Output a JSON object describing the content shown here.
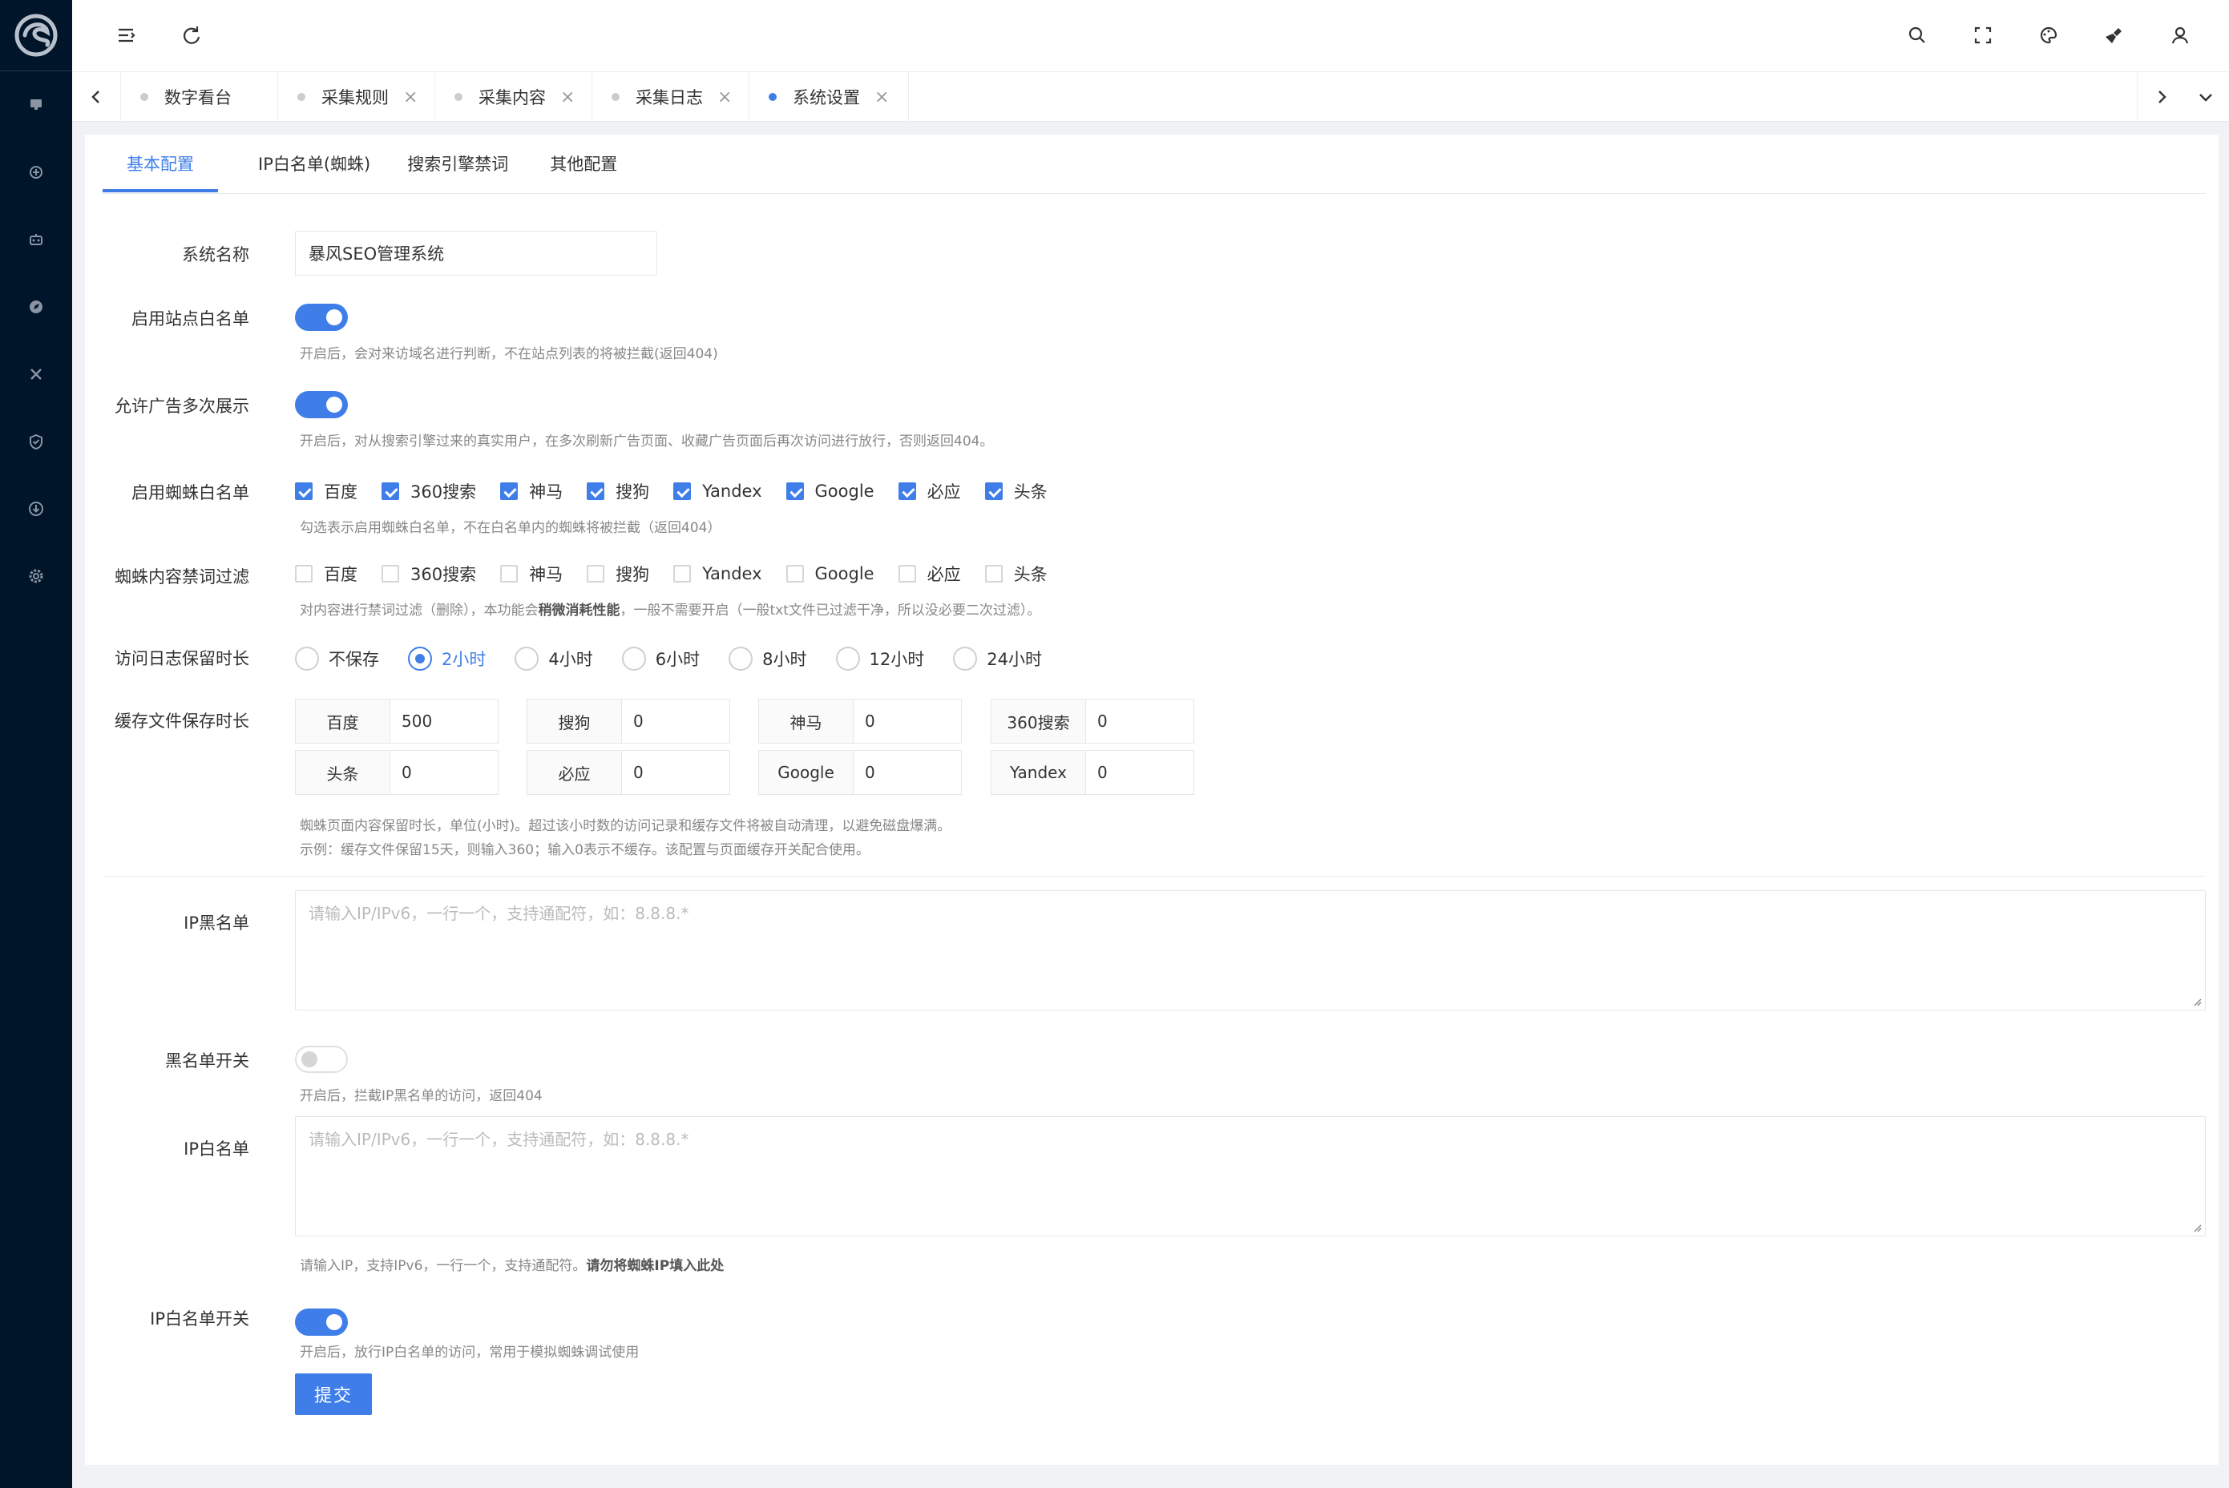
{
  "sidebar": {
    "icons": [
      "dashboard-icon",
      "rules-icon",
      "robot-icon",
      "compass-icon",
      "tools-icon",
      "shield-icon",
      "download-icon",
      "settings-icon"
    ]
  },
  "topbar": {
    "left_icons": [
      "menu-fold-icon",
      "refresh-icon"
    ],
    "right_icons": [
      "search-icon",
      "fullscreen-icon",
      "palette-icon",
      "clean-icon",
      "user-icon"
    ]
  },
  "view_tabs": [
    {
      "label": "数字看台",
      "closable": false,
      "active": false
    },
    {
      "label": "采集规则",
      "closable": true,
      "active": false
    },
    {
      "label": "采集内容",
      "closable": true,
      "active": false
    },
    {
      "label": "采集日志",
      "closable": true,
      "active": false
    },
    {
      "label": "系统设置",
      "closable": true,
      "active": true
    }
  ],
  "form_tabs": [
    "基本配置",
    "IP白名单(蜘蛛)",
    "搜索引擎禁词",
    "其他配置"
  ],
  "labels": {
    "system_name": "系统名称",
    "site_whitelist": "启用站点白名单",
    "ad_multi": "允许广告多次展示",
    "spider_whitelist": "启用蜘蛛白名单",
    "spider_filter": "蜘蛛内容禁词过滤",
    "log_keep": "访问日志保留时长",
    "cache_keep": "缓存文件保存时长",
    "ip_blacklist": "IP黑名单",
    "blacklist_switch": "黑名单开关",
    "ip_whitelist": "IP白名单",
    "ip_whitelist_switch": "IP白名单开关"
  },
  "values": {
    "system_name": "暴风SEO管理系统"
  },
  "hints": {
    "site_whitelist": "开启后，会对来访域名进行判断，不在站点列表的将被拦截(返回404)",
    "ad_multi": "开启后，对从搜索引擎过来的真实用户，在多次刷新广告页面、收藏广告页面后再次访问进行放行，否则返回404。",
    "spider_whitelist": "勾选表示启用蜘蛛白名单，不在白名单内的蜘蛛将被拦截（返回404）",
    "spider_filter_a": "对内容进行禁词过滤（删除），本功能会",
    "spider_filter_b": "稍微消耗性能",
    "spider_filter_c": "，一般不需要开启（一般txt文件已过滤干净，所以没必要二次过滤）。",
    "cache_1": "蜘蛛页面内容保留时长，单位(小时)。超过该小时数的访问记录和缓存文件将被自动清理，以避免磁盘爆满。",
    "cache_2": "示例：缓存文件保留15天，则输入360；输入0表示不缓存。该配置与页面缓存开关配合使用。",
    "blacklist_switch": "开启后，拦截IP黑名单的访问，返回404",
    "ip_whitelist_a": "请输入IP，支持IPv6，一行一个，支持通配符。",
    "ip_whitelist_b": "请勿将蜘蛛IP填入此处",
    "ip_whitelist_switch": "开启后，放行IP白名单的访问，常用于模拟蜘蛛调试使用"
  },
  "spider_engines": [
    "百度",
    "360搜索",
    "神马",
    "搜狗",
    "Yandex",
    "Google",
    "必应",
    "头条"
  ],
  "spider_whitelist_checked": [
    true,
    true,
    true,
    true,
    true,
    true,
    true,
    true
  ],
  "spider_filter_checked": [
    false,
    false,
    false,
    false,
    false,
    false,
    false,
    false
  ],
  "log_options": [
    "不保存",
    "2小时",
    "4小时",
    "6小时",
    "8小时",
    "12小时",
    "24小时"
  ],
  "log_selected": "2小时",
  "cache_rows": [
    [
      {
        "k": "百度",
        "v": "500"
      },
      {
        "k": "搜狗",
        "v": "0"
      },
      {
        "k": "神马",
        "v": "0"
      },
      {
        "k": "360搜索",
        "v": "0"
      }
    ],
    [
      {
        "k": "头条",
        "v": "0"
      },
      {
        "k": "必应",
        "v": "0"
      },
      {
        "k": "Google",
        "v": "0"
      },
      {
        "k": "Yandex",
        "v": "0"
      }
    ]
  ],
  "placeholders": {
    "ip_blacklist": "请输入IP/IPv6，一行一个，支持通配符，如：8.8.8.*",
    "ip_whitelist": "请输入IP/IPv6，一行一个，支持通配符，如：8.8.8.*"
  },
  "switches": {
    "site_whitelist": true,
    "ad_multi": true,
    "blacklist": false,
    "ip_whitelist": true
  },
  "submit_label": "提交",
  "colors": {
    "accent": "#3f7ee8",
    "sidebar": "#001529"
  }
}
